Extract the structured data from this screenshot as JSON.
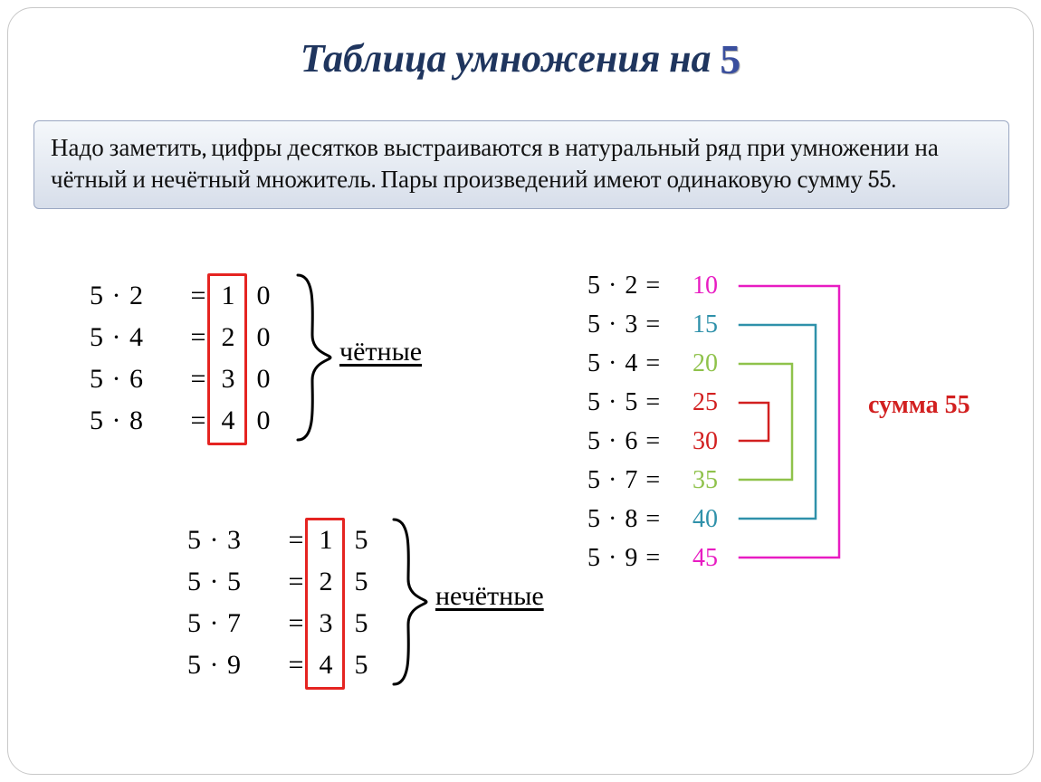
{
  "title": {
    "text": "Таблица умножения на",
    "digit": "5"
  },
  "note": "Надо заметить, цифры десятков выстраиваются в натуральный ряд при умножении на чётный и нечётный множитель. Пары произведений имеют одинаковую сумму 55.",
  "even_label": "чётные",
  "odd_label": "нечётные",
  "sum_label": "сумма 55",
  "even_rows": [
    {
      "lhs": "5 · 2",
      "tens": "1",
      "units": "0"
    },
    {
      "lhs": "5 · 4",
      "tens": "2",
      "units": "0"
    },
    {
      "lhs": "5 · 6",
      "tens": "3",
      "units": "0"
    },
    {
      "lhs": "5 · 8",
      "tens": "4",
      "units": "0"
    }
  ],
  "odd_rows": [
    {
      "lhs": "5 · 3",
      "tens": "1",
      "units": "5"
    },
    {
      "lhs": "5 · 5",
      "tens": "2",
      "units": "5"
    },
    {
      "lhs": "5 · 7",
      "tens": "3",
      "units": "5"
    },
    {
      "lhs": "5 · 9",
      "tens": "4",
      "units": "5"
    }
  ],
  "right_rows": [
    {
      "lhs": "5 · 2 =",
      "val": "10",
      "color": "#e81cc2"
    },
    {
      "lhs": "5 · 3 =",
      "val": "15",
      "color": "#2f91aa"
    },
    {
      "lhs": "5 · 4 =",
      "val": "20",
      "color": "#8fc24b"
    },
    {
      "lhs": "5 · 5 =",
      "val": "25",
      "color": "#d22020"
    },
    {
      "lhs": "5 · 6 =",
      "val": "30",
      "color": "#d22020"
    },
    {
      "lhs": "5 · 7 =",
      "val": "35",
      "color": "#8fc24b"
    },
    {
      "lhs": "5 · 8 =",
      "val": "40",
      "color": "#2f91aa"
    },
    {
      "lhs": "5 · 9 =",
      "val": "45",
      "color": "#e81cc2"
    }
  ],
  "pair_colors": [
    "#e81cc2",
    "#2f91aa",
    "#8fc24b",
    "#d22020"
  ]
}
